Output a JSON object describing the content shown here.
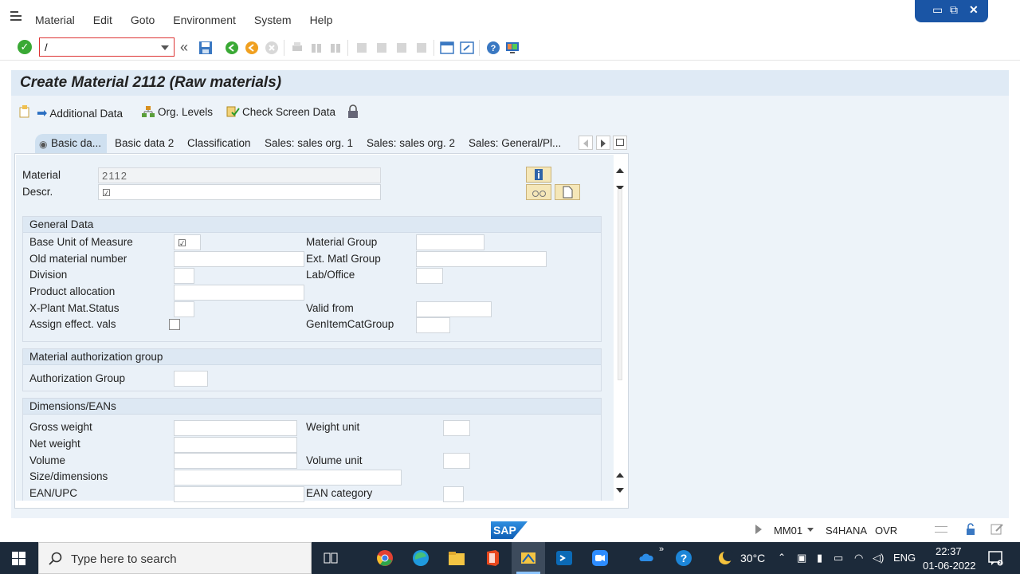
{
  "menu": [
    "Material",
    "Edit",
    "Goto",
    "Environment",
    "System",
    "Help"
  ],
  "command_field": {
    "value": "/"
  },
  "page_title": "Create Material 2112 (Raw materials)",
  "app_toolbar": {
    "additional_data": "Additional Data",
    "org_levels": "Org. Levels",
    "check_screen_data": "Check Screen Data"
  },
  "tabs": [
    "Basic da...",
    "Basic data 2",
    "Classification",
    "Sales: sales org. 1",
    "Sales: sales org. 2",
    "Sales: General/Pl..."
  ],
  "header": {
    "material_label": "Material",
    "material_value": "2112",
    "descr_label": "Descr."
  },
  "general_data": {
    "title": "General Data",
    "base_uom": "Base Unit of Measure",
    "old_material": "Old material number",
    "division": "Division",
    "product_allocation": "Product allocation",
    "xplant_status": "X-Plant Mat.Status",
    "assign_effect": "Assign effect. vals",
    "material_group": "Material Group",
    "ext_matl_group": "Ext. Matl Group",
    "lab_office": "Lab/Office",
    "valid_from": "Valid from",
    "gen_item_cat_group": "GenItemCatGroup"
  },
  "auth_group": {
    "title": "Material authorization group",
    "authorization_group": "Authorization Group"
  },
  "dimensions": {
    "title": "Dimensions/EANs",
    "gross_weight": "Gross weight",
    "net_weight": "Net weight",
    "volume": "Volume",
    "size_dimensions": "Size/dimensions",
    "ean_upc": "EAN/UPC",
    "weight_unit": "Weight unit",
    "volume_unit": "Volume unit",
    "ean_category": "EAN category"
  },
  "status": {
    "transaction": "MM01",
    "system": "S4HANA",
    "mode": "OVR"
  },
  "taskbar": {
    "search_placeholder": "Type here to search",
    "weather": "30°C",
    "language": "ENG",
    "time": "22:37",
    "date": "01-06-2022"
  }
}
